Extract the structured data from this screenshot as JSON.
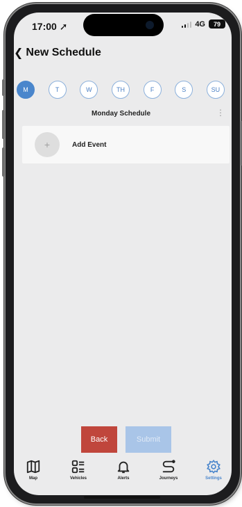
{
  "status": {
    "time": "17:00",
    "network": "4G",
    "battery": "79"
  },
  "header": {
    "title": "New Schedule"
  },
  "days": [
    {
      "label": "M",
      "selected": true
    },
    {
      "label": "T",
      "selected": false
    },
    {
      "label": "W",
      "selected": false
    },
    {
      "label": "TH",
      "selected": false
    },
    {
      "label": "F",
      "selected": false
    },
    {
      "label": "S",
      "selected": false
    },
    {
      "label": "SU",
      "selected": false
    }
  ],
  "schedule": {
    "title": "Monday Schedule",
    "menu_icon": "more-vertical-icon"
  },
  "event": {
    "add_label": "Add Event",
    "add_icon": "plus-icon"
  },
  "actions": {
    "back_label": "Back",
    "submit_label": "Submit",
    "back_color": "#c0463c",
    "submit_color": "#a9c5e8"
  },
  "tabs": [
    {
      "label": "Map",
      "icon": "map-icon"
    },
    {
      "label": "Vehicles",
      "icon": "vehicles-icon"
    },
    {
      "label": "Alerts",
      "icon": "bell-icon"
    },
    {
      "label": "Journeys",
      "icon": "route-icon"
    },
    {
      "label": "Settings",
      "icon": "gear-icon",
      "active": true
    }
  ],
  "colors": {
    "accent": "#4a86cc",
    "background": "#ebebec"
  }
}
